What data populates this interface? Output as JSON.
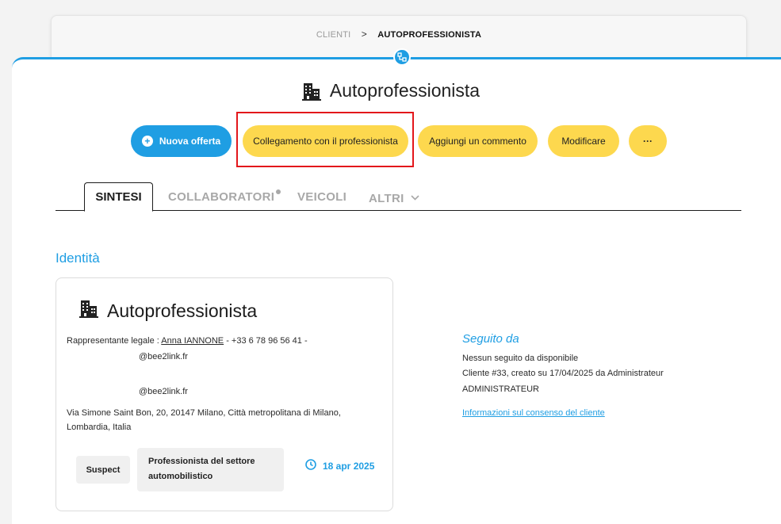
{
  "breadcrumb": {
    "parent": "CLIENTI",
    "separator": ">",
    "current": "AUTOPROFESSIONISTA"
  },
  "page": {
    "title": "Autoprofessionista"
  },
  "actions": {
    "new_offer": "Nuova offerta",
    "link_professional": "Collegamento con il professionista",
    "add_comment": "Aggiungi un commento",
    "edit": "Modificare",
    "more": "···"
  },
  "tabs": {
    "summary": "SINTESI",
    "collaborators": "COLLABORATORI",
    "vehicles": "VEICOLI",
    "others": "ALTRI"
  },
  "identity": {
    "section_title": "Identità",
    "card_title": "Autoprofessionista",
    "rep_prefix": "Rappresentante legale : ",
    "rep_name": "Anna IANNONE",
    "rep_phone": " - +33 6 78 96 56 41 -",
    "email1": "@bee2link.fr",
    "email2": "@bee2link.fr",
    "address_line1": "Via Simone Saint Bon, 20, 20147 Milano, Città metropolitana di Milano,",
    "address_line2": "Lombardia, Italia",
    "status": "Suspect",
    "category_line1": "Professionista del settore",
    "category_line2": "automobilistico",
    "date": "18 apr 2025"
  },
  "followed": {
    "title": "Seguito da",
    "none": "Nessun seguito da disponibile",
    "client_info": "Cliente #33, creato su 17/04/2025 da Administrateur",
    "admin": "ADMINISTRATEUR",
    "consent_link": "Informazioni sul consenso del cliente"
  },
  "colors": {
    "accent": "#1f9ee3",
    "button_yellow": "#fdd84e",
    "highlight": "#e3171b"
  }
}
